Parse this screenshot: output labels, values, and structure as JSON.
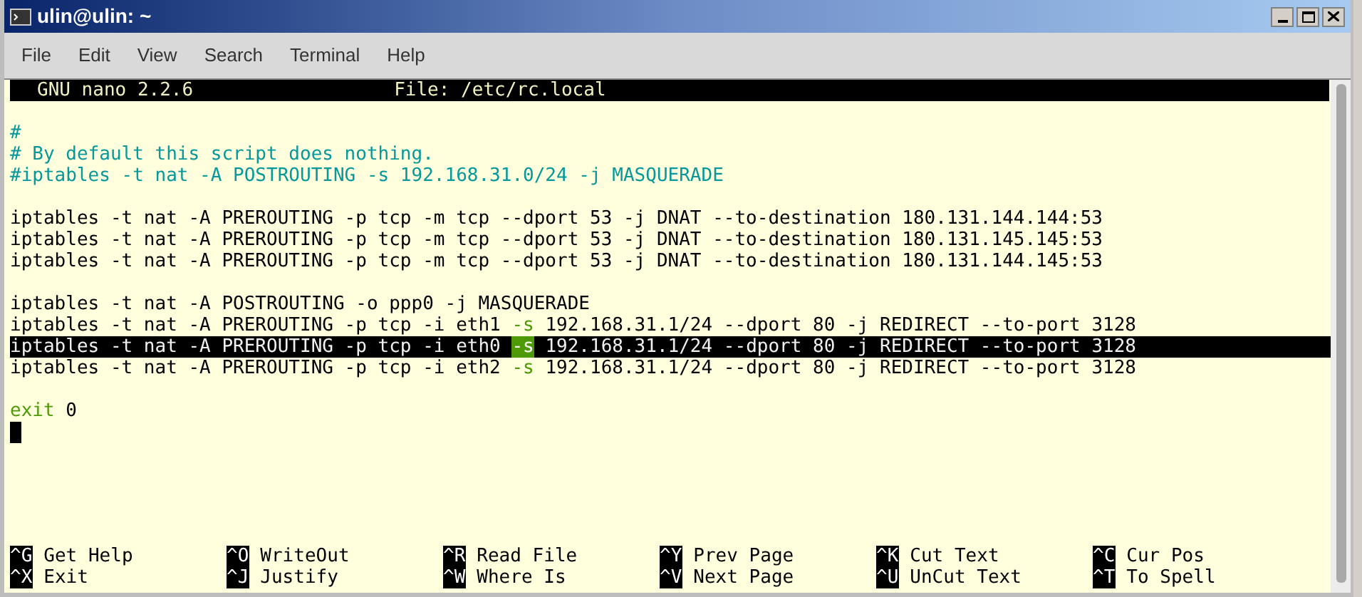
{
  "window": {
    "title": "ulin@ulin: ~"
  },
  "menu": [
    "File",
    "Edit",
    "View",
    "Search",
    "Terminal",
    "Help"
  ],
  "nano_header": {
    "version": "GNU nano 2.2.6",
    "file": "File: /etc/rc.local"
  },
  "blocks": [
    [
      {
        "selected": false,
        "segments": [
          {
            "kind": "comment",
            "text": "#"
          }
        ]
      },
      {
        "selected": false,
        "segments": [
          {
            "kind": "comment",
            "text": "# By default this script does nothing."
          }
        ]
      },
      {
        "selected": false,
        "segments": [
          {
            "kind": "comment",
            "text": "#iptables -t nat -A POSTROUTING -s 192.168.31.0/24 -j MASQUERADE"
          }
        ]
      }
    ],
    [
      {
        "selected": false,
        "segments": [
          {
            "kind": "plain",
            "text": "iptables -t nat -A PREROUTING -p tcp -m tcp --dport 53 -j DNAT --to-destination 180.131.144.144:53"
          }
        ]
      },
      {
        "selected": false,
        "segments": [
          {
            "kind": "plain",
            "text": "iptables -t nat -A PREROUTING -p tcp -m tcp --dport 53 -j DNAT --to-destination 180.131.145.145:53"
          }
        ]
      },
      {
        "selected": false,
        "segments": [
          {
            "kind": "plain",
            "text": "iptables -t nat -A PREROUTING -p tcp -m tcp --dport 53 -j DNAT --to-destination 180.131.144.145:53"
          }
        ]
      }
    ],
    [
      {
        "selected": false,
        "segments": [
          {
            "kind": "plain",
            "text": "iptables -t nat -A POSTROUTING -o ppp0 -j MASQUERADE"
          }
        ]
      },
      {
        "selected": false,
        "segments": [
          {
            "kind": "plain",
            "text": "iptables -t nat -A PREROUTING -p tcp -i eth1"
          },
          {
            "kind": "keyword",
            "text": "-s"
          },
          {
            "kind": "plain",
            "text": "192.168.31.1/24 --dport 80 -j REDIRECT --to-port 3128"
          }
        ]
      },
      {
        "selected": true,
        "segments": [
          {
            "kind": "plain",
            "text": "iptables -t nat -A PREROUTING -p tcp -i eth0"
          },
          {
            "kind": "keyword",
            "text": "-s"
          },
          {
            "kind": "plain",
            "text": "192.168.31.1/24 --dport 80 -j REDIRECT --to-port 3128"
          }
        ]
      },
      {
        "selected": false,
        "segments": [
          {
            "kind": "plain",
            "text": "iptables -t nat -A PREROUTING -p tcp -i eth2"
          },
          {
            "kind": "keyword",
            "text": "-s"
          },
          {
            "kind": "plain",
            "text": "192.168.31.1/24 --dport 80 -j REDIRECT --to-port 3128"
          }
        ]
      }
    ],
    [
      {
        "selected": false,
        "segments": [
          {
            "kind": "keyword",
            "text": "exit"
          },
          {
            "kind": "plain",
            "text": "0"
          }
        ]
      }
    ]
  ],
  "cursor": {
    "visible": true
  },
  "shortcuts": [
    [
      {
        "key": "^G",
        "label": "Get Help"
      },
      {
        "key": "^O",
        "label": "WriteOut"
      },
      {
        "key": "^R",
        "label": "Read File"
      },
      {
        "key": "^Y",
        "label": "Prev Page"
      },
      {
        "key": "^K",
        "label": "Cut Text"
      },
      {
        "key": "^C",
        "label": "Cur Pos"
      }
    ],
    [
      {
        "key": "^X",
        "label": "Exit"
      },
      {
        "key": "^J",
        "label": "Justify"
      },
      {
        "key": "^W",
        "label": "Where Is"
      },
      {
        "key": "^V",
        "label": "Next Page"
      },
      {
        "key": "^U",
        "label": "UnCut Text"
      },
      {
        "key": "^T",
        "label": "To Spell"
      }
    ]
  ]
}
